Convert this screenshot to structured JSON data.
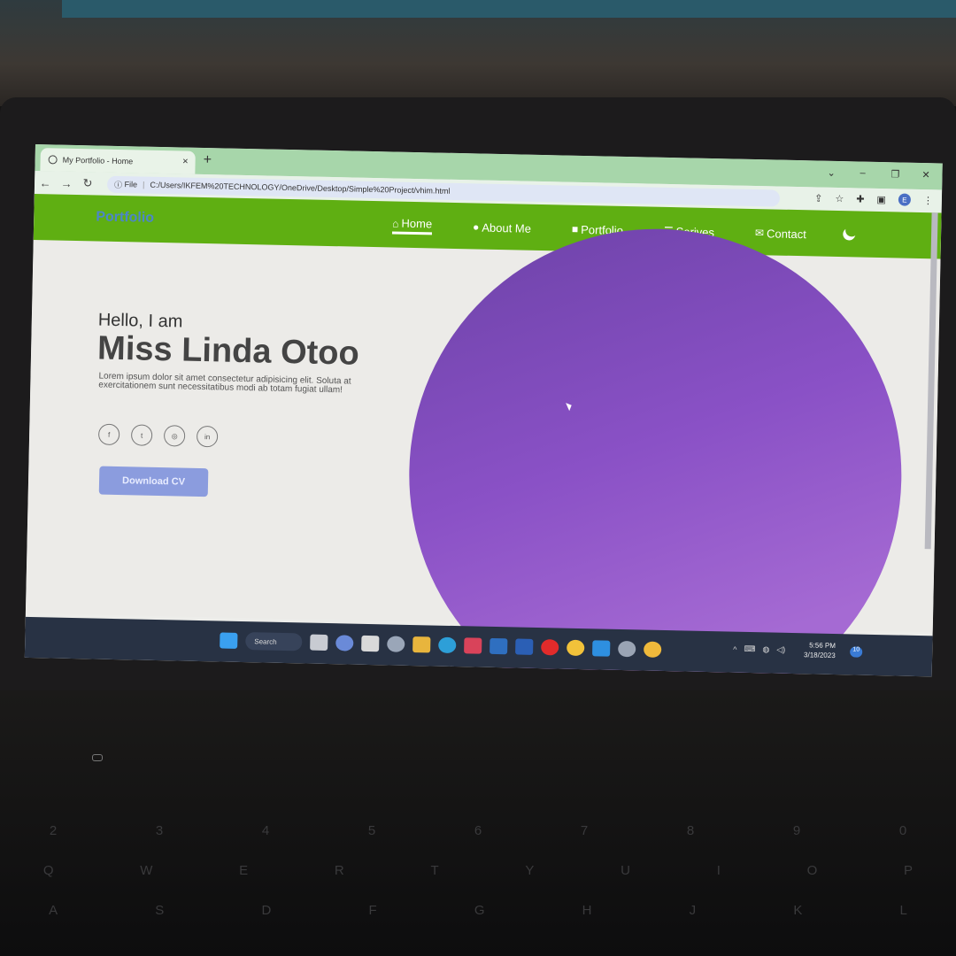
{
  "browser": {
    "tab_title": "My Portfolio - Home",
    "tab_close": "×",
    "new_tab": "+",
    "url_scheme_label": "File",
    "url": "C:/Users/IKFEM%20TECHNOLOGY/OneDrive/Desktop/Simple%20Project/vhim.html",
    "profile_initial": "E",
    "window_controls": [
      "⌄",
      "–",
      "❐",
      "✕"
    ]
  },
  "site": {
    "logo": "Portfolio",
    "nav": [
      {
        "label": "Home",
        "icon": "home-icon",
        "active": true
      },
      {
        "label": "About Me",
        "icon": "user-icon",
        "active": false
      },
      {
        "label": "Portfolio",
        "icon": "briefcase-icon",
        "active": false
      },
      {
        "label": "Serives",
        "icon": "server-icon",
        "active": false
      },
      {
        "label": "Contact",
        "icon": "envelope-icon",
        "active": false
      }
    ],
    "greeting": "Hello, I am",
    "name": "Miss Linda Otoo",
    "description": "Lorem ipsum dolor sit amet consectetur adipisicing elit. Soluta at exercitationem sunt necessitatibus modi ab totam fugiat ullam!",
    "socials": [
      "facebook-icon",
      "twitter-icon",
      "instagram-icon",
      "linkedin-icon"
    ],
    "cta": "Download CV",
    "colors": {
      "nav_bg": "#5faf12",
      "circle": "#8a51c6",
      "button": "#8b9cde",
      "logo": "#4c86c7"
    }
  },
  "taskbar": {
    "search_label": "Search",
    "time": "5:56 PM",
    "date": "3/18/2023",
    "notification_count": "10"
  },
  "keyboard": {
    "row1": [
      "2",
      "3",
      "4",
      "5",
      "6",
      "7",
      "8",
      "9",
      "0"
    ],
    "row2": [
      "Q",
      "W",
      "E",
      "R",
      "T",
      "Y",
      "U",
      "I",
      "O",
      "P"
    ],
    "row3": [
      "A",
      "S",
      "D",
      "F",
      "G",
      "H",
      "J",
      "K",
      "L"
    ]
  }
}
